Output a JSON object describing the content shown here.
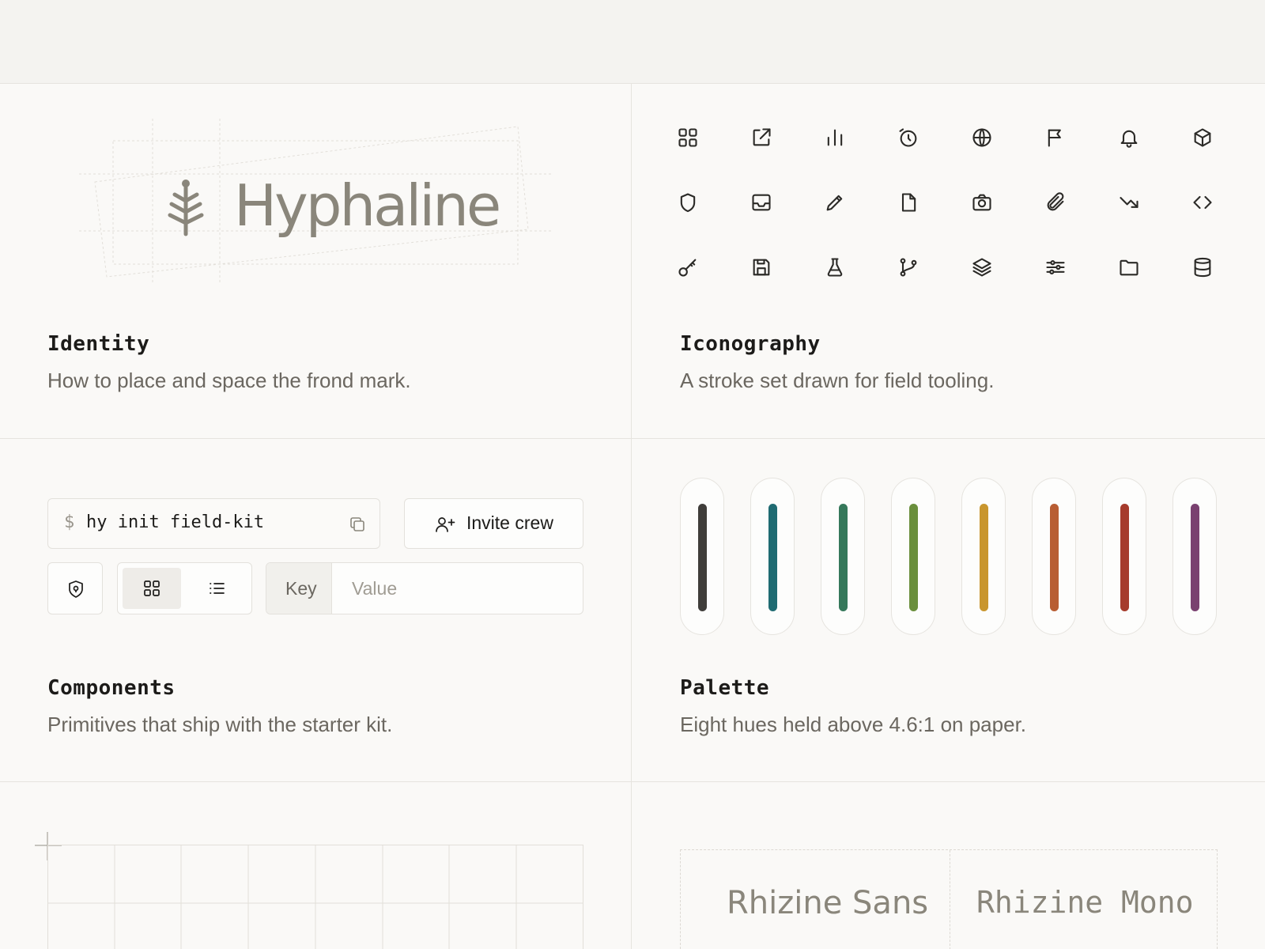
{
  "identity": {
    "wordmark": "Hyphaline",
    "title": "Identity",
    "description": "How to place and space the frond mark."
  },
  "iconography": {
    "title": "Iconography",
    "description": "A stroke set drawn for field tooling.",
    "icons": [
      "grid-icon",
      "external-link-icon",
      "bar-chart-icon",
      "alarm-clock-icon",
      "globe-icon",
      "flag-icon",
      "bell-icon",
      "box-icon",
      "shield-icon",
      "inbox-icon",
      "pencil-icon",
      "file-icon",
      "camera-icon",
      "paperclip-icon",
      "trending-down-icon",
      "code-icon",
      "key-icon",
      "save-icon",
      "flask-icon",
      "git-branch-icon",
      "layers-icon",
      "sliders-icon",
      "folder-icon",
      "database-icon"
    ]
  },
  "components": {
    "title": "Components",
    "description": "Primitives that ship with the starter kit.",
    "command": {
      "prompt": "$",
      "text": "hy init field-kit"
    },
    "invite_label": "Invite crew",
    "kv": {
      "key_label": "Key",
      "value_placeholder": "Value"
    },
    "view_toggle": {
      "selected": "grid"
    }
  },
  "palette": {
    "title": "Palette",
    "description": "Eight hues held above 4.6:1 on paper.",
    "colors": [
      "#3f3d3a",
      "#1f6b72",
      "#35785a",
      "#6a8f3c",
      "#c9962e",
      "#b85d33",
      "#a63b2c",
      "#7a4170"
    ]
  },
  "typography": {
    "sans_name": "Rhizine Sans",
    "mono_name": "Rhizine Mono"
  }
}
